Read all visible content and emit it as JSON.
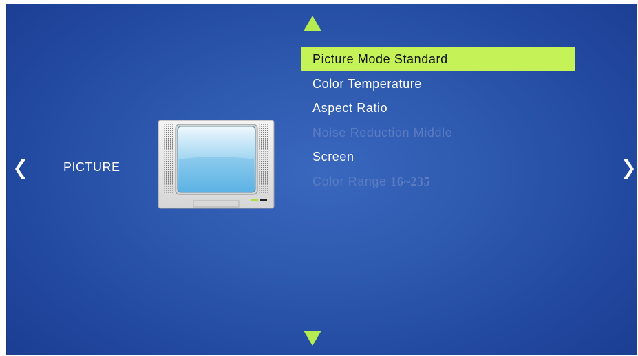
{
  "category": {
    "label": "PICTURE",
    "icon": "tv-icon"
  },
  "navigation": {
    "up_icon": "triangle-up-icon",
    "down_icon": "triangle-down-icon",
    "prev_icon": "chevron-left-icon",
    "next_icon": "chevron-right-icon"
  },
  "menu": {
    "items": [
      {
        "label": "Picture Mode Standard",
        "state": "selected"
      },
      {
        "label": "Color Temperature",
        "state": "enabled"
      },
      {
        "label": "Aspect Ratio",
        "state": "enabled"
      },
      {
        "label": "Noise Reduction Middle",
        "state": "disabled"
      },
      {
        "label": "Screen",
        "state": "enabled"
      },
      {
        "label": "Color Range ",
        "value": "16~235",
        "state": "disabled"
      }
    ]
  },
  "colors": {
    "background": "#2d59ae",
    "highlight": "#c4f257",
    "arrow": "#b6ec52",
    "disabled_text": "#5c7cc2",
    "text": "#ffffff"
  }
}
